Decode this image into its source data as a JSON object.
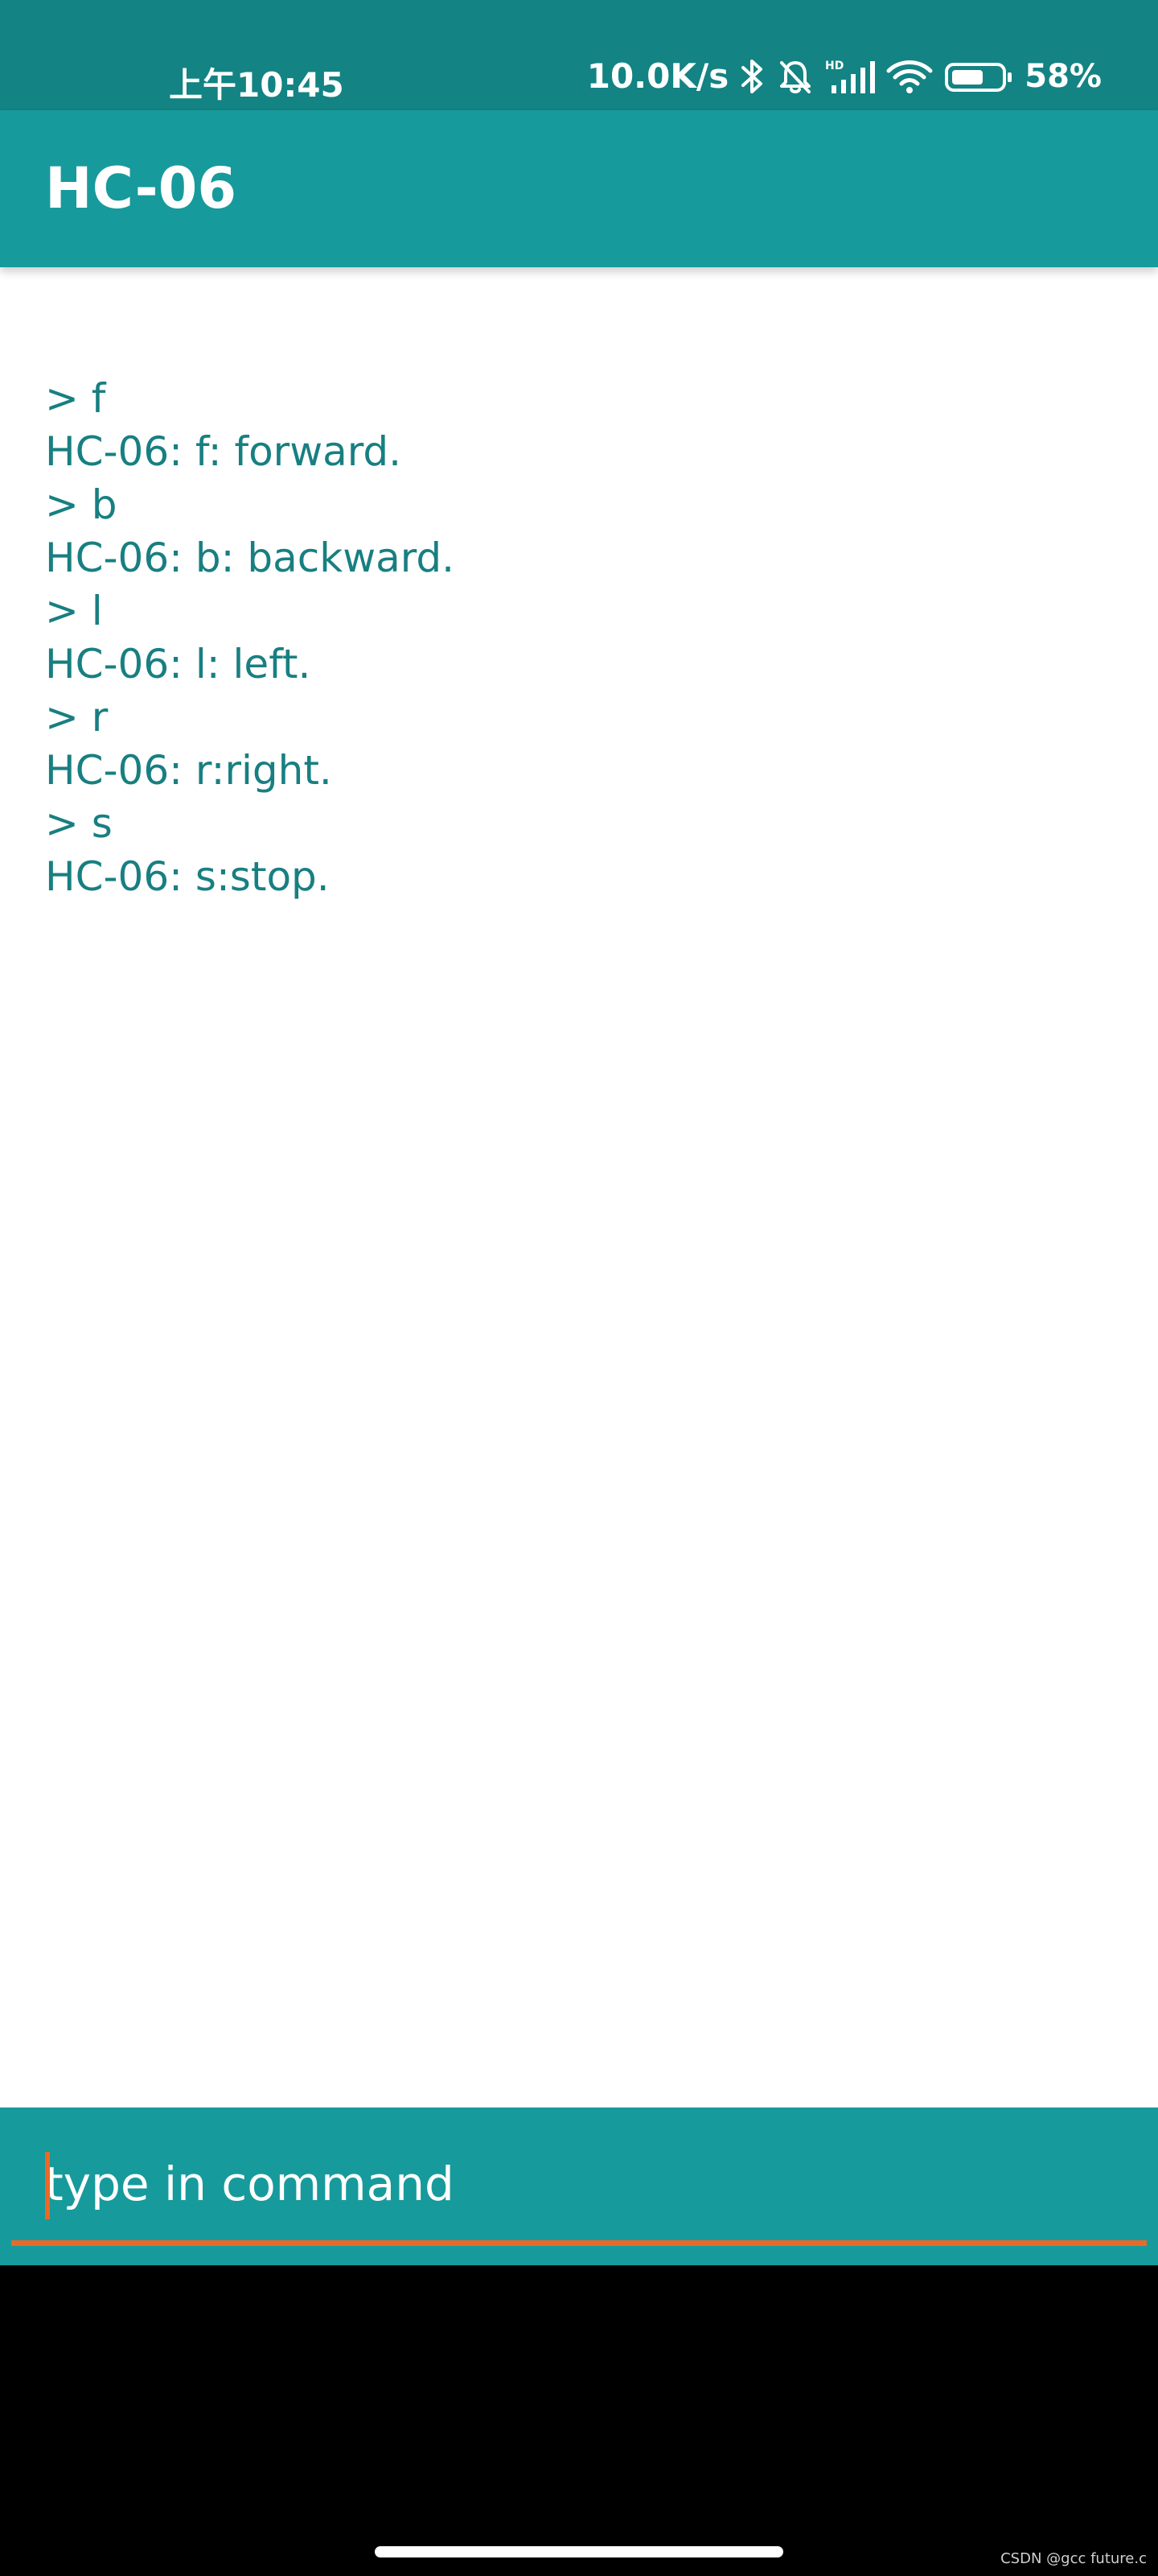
{
  "status_bar": {
    "time": "上午10:45",
    "network_speed": "10.0K/s",
    "battery_percent": "58%",
    "icons": [
      "bluetooth-icon",
      "bell-off-icon",
      "hd-signal-icon",
      "wifi-icon",
      "battery-icon"
    ],
    "signal_badge": "HD"
  },
  "app_bar": {
    "title": "HC-06"
  },
  "terminal": {
    "lines": [
      "> f",
      "HC-06: f: forward.",
      "> b",
      "HC-06: b: backward.",
      "> l",
      "HC-06: l: left.",
      "> r",
      "HC-06: r:right.",
      "> s",
      "HC-06: s:stop."
    ]
  },
  "command": {
    "placeholder": "type in command",
    "value": ""
  },
  "watermark": "CSDN @gcc future.c",
  "colors": {
    "status_bar": "#138383",
    "app_bar": "#179a9c",
    "terminal_text": "#187f81",
    "accent": "#e86a28",
    "nav_background": "#000000"
  }
}
